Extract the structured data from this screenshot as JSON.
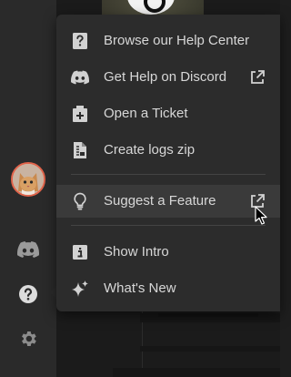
{
  "colors": {
    "menu_bg": "#2c2c2c",
    "menu_hover_bg": "#3a3a3a",
    "menu_text": "#d7d7d7",
    "icon": "#d2d2d2",
    "rail_icon": "#9a9a9a",
    "avatar_ring": "#e0634a"
  },
  "help_menu": {
    "items": [
      {
        "label": "Browse our Help Center",
        "icon": "help-center-icon"
      },
      {
        "label": "Get Help on Discord",
        "icon": "discord-icon",
        "external": true
      },
      {
        "label": "Open a Ticket",
        "icon": "ticket-icon"
      },
      {
        "label": "Create logs zip",
        "icon": "zip-file-icon"
      },
      {
        "label": "Suggest a Feature",
        "icon": "lightbulb-icon",
        "external": true,
        "hovered": true
      },
      {
        "label": "Show Intro",
        "icon": "info-icon"
      },
      {
        "label": "What's New",
        "icon": "sparkle-icon"
      }
    ]
  },
  "rail": {
    "items": [
      "avatar",
      "discord-icon",
      "help-icon",
      "gear-icon"
    ],
    "active": "help-icon"
  }
}
